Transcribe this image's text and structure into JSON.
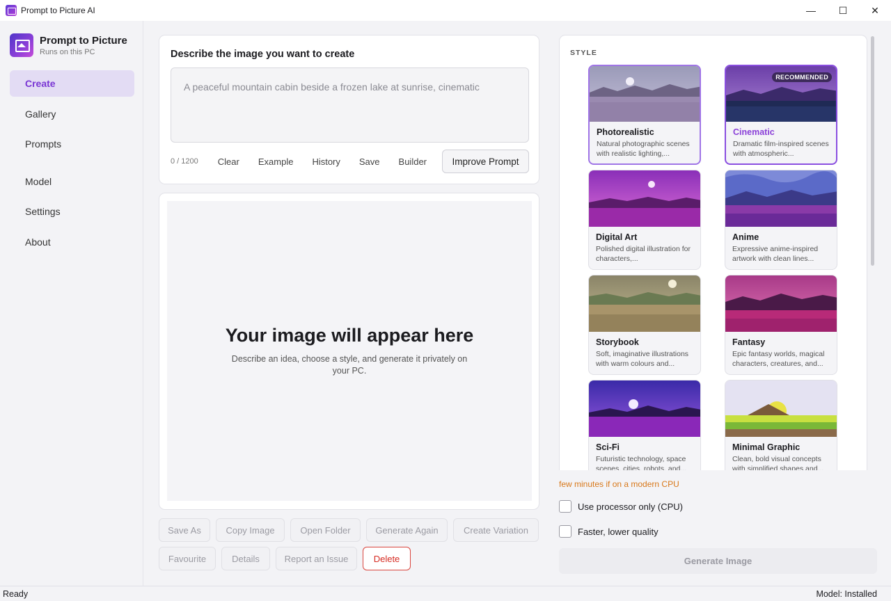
{
  "window": {
    "title": "Prompt to Picture AI",
    "controls": [
      "—",
      "☐",
      "✕"
    ]
  },
  "brand": {
    "name": "Prompt to Picture",
    "subtitle": "Runs on this PC"
  },
  "nav": {
    "items": [
      {
        "label": "Create",
        "active": true
      },
      {
        "label": "Gallery"
      },
      {
        "label": "Prompts"
      },
      {
        "label": "Model"
      },
      {
        "label": "Settings"
      },
      {
        "label": "About"
      }
    ]
  },
  "prompt": {
    "title": "Describe the image you want to create",
    "placeholder": "A peaceful mountain cabin beside a frozen lake at sunrise, cinematic",
    "char_count": "0 / 1200",
    "links": [
      "Clear",
      "Example",
      "History",
      "Save",
      "Builder"
    ],
    "improve_label": "Improve Prompt"
  },
  "preview": {
    "title": "Your image will appear here",
    "subtitle": "Describe an idea, choose a style, and generate it privately on your PC."
  },
  "actions": {
    "row1": [
      "Save As",
      "Copy Image",
      "Open Folder",
      "Generate Again",
      "Create Variation"
    ],
    "row2": [
      "Favourite",
      "Details",
      "Report an Issue",
      "Delete"
    ]
  },
  "style": {
    "label": "STYLE",
    "recommended_badge": "RECOMMENDED",
    "cards": [
      {
        "name": "Photorealistic",
        "desc": "Natural photographic scenes with realistic lighting,...",
        "selected": true
      },
      {
        "name": "Cinematic",
        "desc": "Dramatic film-inspired scenes with atmospheric...",
        "selected": true,
        "recommended": true
      },
      {
        "name": "Digital Art",
        "desc": "Polished digital illustration for characters,..."
      },
      {
        "name": "Anime",
        "desc": "Expressive anime-inspired artwork with clean lines..."
      },
      {
        "name": "Storybook",
        "desc": "Soft, imaginative illustrations with warm colours and..."
      },
      {
        "name": "Fantasy",
        "desc": "Epic fantasy worlds, magical characters, creatures, and..."
      },
      {
        "name": "Sci-Fi",
        "desc": "Futuristic technology, space scenes, cities, robots, and..."
      },
      {
        "name": "Minimal Graphic",
        "desc": "Clean, bold visual concepts with simplified shapes and..."
      }
    ]
  },
  "generate": {
    "warning": "few minutes if on a modern CPU",
    "cpu_only_label": "Use processor only (CPU)",
    "faster_label": "Faster, lower quality",
    "button_label": "Generate Image"
  },
  "status": {
    "left": "Ready",
    "right": "Model: Installed"
  },
  "colors": {
    "accent": "#7a36d4",
    "nav_active_bg": "#e3dcf4",
    "danger": "#d62b22",
    "warning": "#d8781a"
  }
}
